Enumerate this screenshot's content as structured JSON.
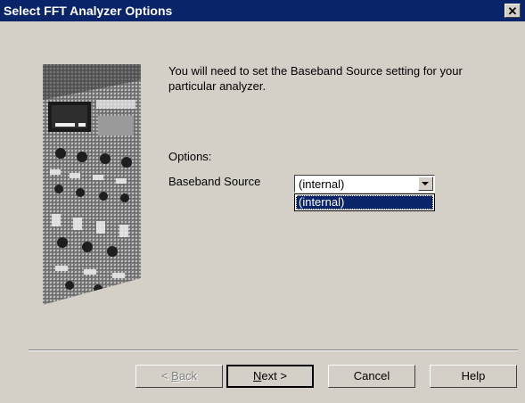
{
  "window": {
    "title": "Select FFT Analyzer Options",
    "close_glyph": "✕"
  },
  "content": {
    "intro": "You will need to set the Baseband Source setting for your particular analyzer.",
    "options_label": "Options:",
    "baseband_label": "Baseband Source"
  },
  "combo": {
    "value": "(internal)",
    "open": true,
    "options": [
      "(internal)"
    ],
    "highlighted_option": "(internal)"
  },
  "buttons": {
    "back_accel": "B",
    "back_rest": "ack",
    "back_prefix": "< ",
    "next_accel": "N",
    "next_rest": "ext >",
    "cancel": "Cancel",
    "help": "Help"
  },
  "icons": {
    "illustration": "wizard-instrument-panel-image",
    "combo_arrow": "chevron-down-icon",
    "close": "close-icon"
  },
  "colors": {
    "titlebar": "#0a246a",
    "dialog_bg": "#d4d0c8",
    "selection": "#0a246a"
  }
}
